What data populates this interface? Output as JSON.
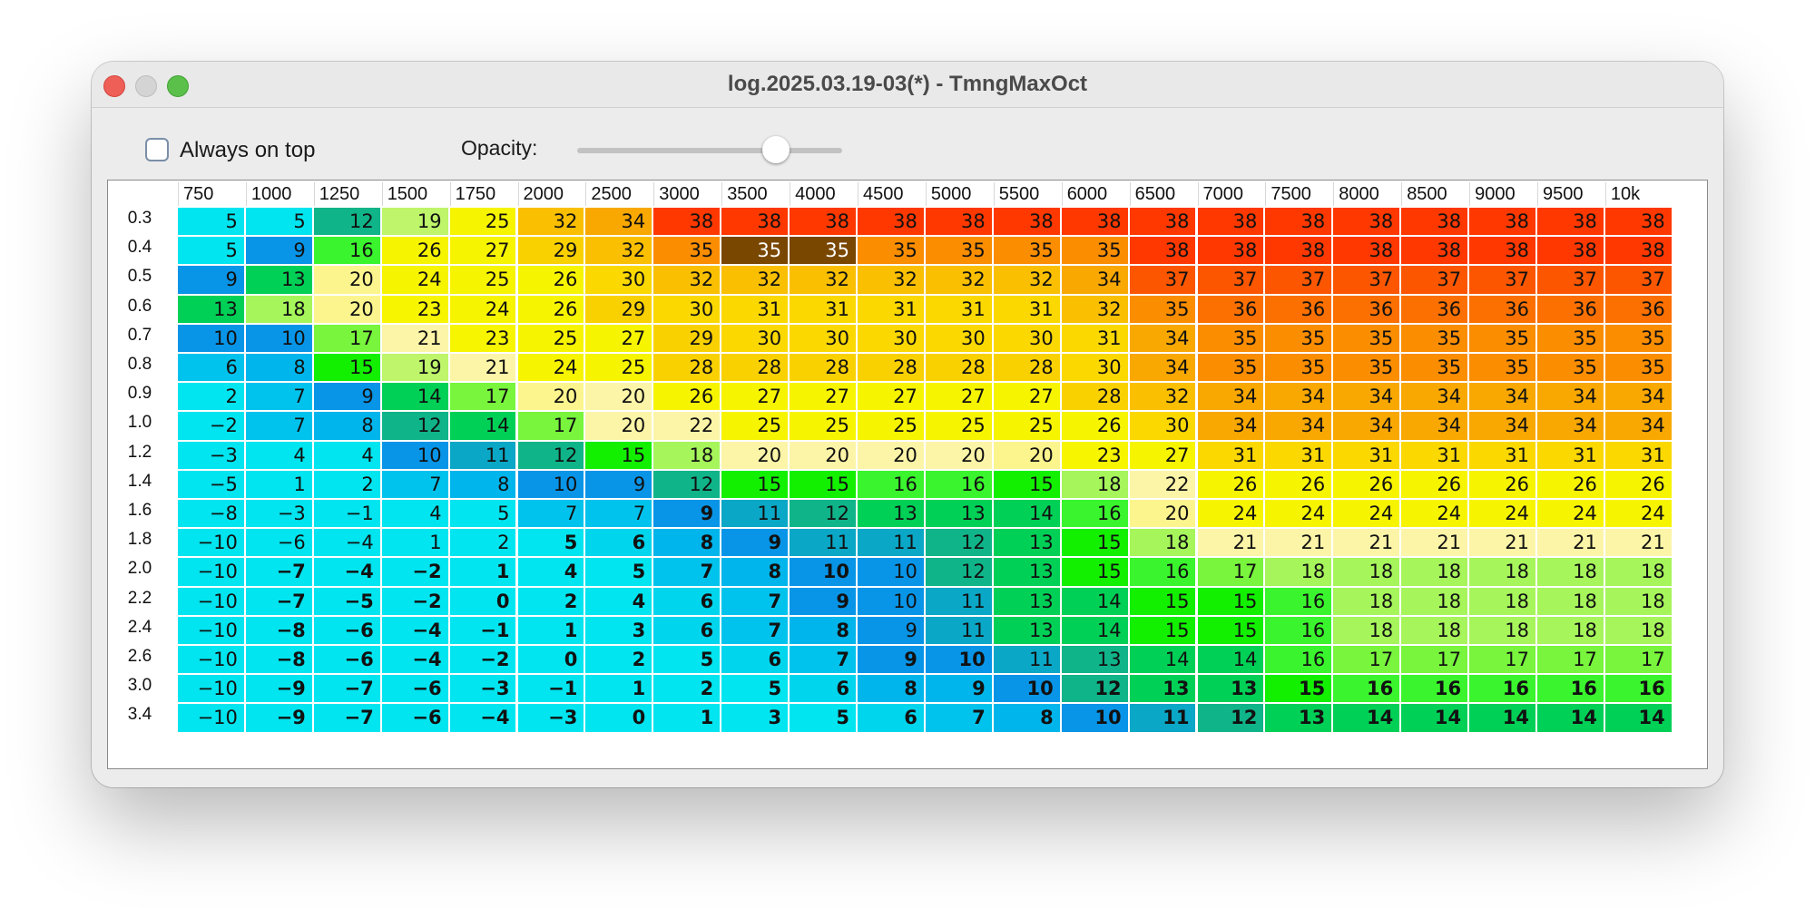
{
  "window": {
    "title": "log.2025.03.19-03(*) - TmngMaxOct"
  },
  "toolbar": {
    "always_on_top_label": "Always on top",
    "always_on_top_checked": false,
    "opacity_label": "Opacity:",
    "opacity_value": 0.75
  },
  "table": {
    "columns": [
      "750",
      "1000",
      "1250",
      "1500",
      "1750",
      "2000",
      "2500",
      "3000",
      "3500",
      "4000",
      "4500",
      "5000",
      "5500",
      "6000",
      "6500",
      "7000",
      "7500",
      "8000",
      "8500",
      "9000",
      "9500",
      "10k"
    ],
    "rows": [
      {
        "label": "0.3",
        "values": [
          "5",
          "5",
          "12",
          "19",
          "25",
          "32",
          "34",
          "38",
          "38",
          "38",
          "38",
          "38",
          "38",
          "38",
          "38",
          "38",
          "38",
          "38",
          "38",
          "38",
          "38",
          "38"
        ],
        "colors": [
          "#00e5ef",
          "#00e5ef",
          "#10b489",
          "#bef56a",
          "#f7f400",
          "#f9bf00",
          "#f8a800",
          "#ff3800",
          "#ff3800",
          "#ff3800",
          "#ff3800",
          "#ff3800",
          "#ff3800",
          "#ff3800",
          "#ff3800",
          "#ff3800",
          "#ff3800",
          "#ff3800",
          "#ff3800",
          "#ff3800",
          "#ff3800",
          "#ff3800"
        ]
      },
      {
        "label": "0.4",
        "values": [
          "5",
          "9",
          "16",
          "26",
          "27",
          "29",
          "32",
          "35",
          "35",
          "35",
          "35",
          "35",
          "35",
          "35",
          "38",
          "38",
          "38",
          "38",
          "38",
          "38",
          "38",
          "38"
        ],
        "colors": [
          "#00e5ef",
          "#0895e8",
          "#3af52d",
          "#f7f400",
          "#f7f400",
          "#fad100",
          "#f9bf00",
          "#fb8d00",
          "#7a4700",
          "#7a4700",
          "#fb8d00",
          "#fb8d00",
          "#fb8d00",
          "#fb8d00",
          "#ff3800",
          "#ff3800",
          "#ff3800",
          "#ff3800",
          "#ff3800",
          "#ff3800",
          "#ff3800",
          "#ff3800"
        ]
      },
      {
        "label": "0.5",
        "values": [
          "9",
          "13",
          "20",
          "24",
          "25",
          "26",
          "30",
          "32",
          "32",
          "32",
          "32",
          "32",
          "32",
          "34",
          "37",
          "37",
          "37",
          "37",
          "37",
          "37",
          "37",
          "37"
        ],
        "colors": [
          "#0895e8",
          "#00d056",
          "#fcf58e",
          "#f7f400",
          "#f7f400",
          "#f7f400",
          "#fbd800",
          "#f9bf00",
          "#f9bf00",
          "#f9bf00",
          "#f9bf00",
          "#f9bf00",
          "#f9bf00",
          "#f8a800",
          "#fc5600",
          "#fc5600",
          "#fc5600",
          "#fc5600",
          "#fc5600",
          "#fc5600",
          "#fc5600",
          "#fc5600"
        ]
      },
      {
        "label": "0.6",
        "values": [
          "13",
          "18",
          "20",
          "23",
          "24",
          "26",
          "29",
          "30",
          "31",
          "31",
          "31",
          "31",
          "31",
          "32",
          "35",
          "36",
          "36",
          "36",
          "36",
          "36",
          "36",
          "36"
        ],
        "colors": [
          "#00d056",
          "#a6f55b",
          "#fcf58e",
          "#f8f500",
          "#f7f400",
          "#f7f400",
          "#fad100",
          "#fbd800",
          "#fbd800",
          "#fbd800",
          "#fbd800",
          "#fbd800",
          "#fbd800",
          "#f9bf00",
          "#fb8d00",
          "#fb7000",
          "#fb7000",
          "#fb7000",
          "#fb7000",
          "#fb7000",
          "#fb7000",
          "#fb7000"
        ]
      },
      {
        "label": "0.7",
        "values": [
          "10",
          "10",
          "17",
          "21",
          "23",
          "25",
          "27",
          "29",
          "30",
          "30",
          "30",
          "30",
          "30",
          "31",
          "34",
          "35",
          "35",
          "35",
          "35",
          "35",
          "35",
          "35"
        ],
        "colors": [
          "#0895e8",
          "#0895e8",
          "#78f53c",
          "#fcf5a8",
          "#f8f500",
          "#f7f400",
          "#f7f400",
          "#fad100",
          "#fbd800",
          "#fbd800",
          "#fbd800",
          "#fbd800",
          "#fbd800",
          "#fbd800",
          "#f8a800",
          "#fb8d00",
          "#fb8d00",
          "#fb8d00",
          "#fb8d00",
          "#fb8d00",
          "#fb8d00",
          "#fb8d00"
        ]
      },
      {
        "label": "0.8",
        "values": [
          "6",
          "8",
          "15",
          "19",
          "21",
          "24",
          "25",
          "28",
          "28",
          "28",
          "28",
          "28",
          "28",
          "30",
          "34",
          "35",
          "35",
          "35",
          "35",
          "35",
          "35",
          "35"
        ],
        "colors": [
          "#00c3ed",
          "#00b5eb",
          "#12f000",
          "#bef56a",
          "#fcf5a8",
          "#f7f400",
          "#f7f400",
          "#fad100",
          "#fad100",
          "#fad100",
          "#fad100",
          "#fad100",
          "#fad100",
          "#fbd800",
          "#f8a800",
          "#fb8d00",
          "#fb8d00",
          "#fb8d00",
          "#fb8d00",
          "#fb8d00",
          "#fb8d00",
          "#fb8d00"
        ]
      },
      {
        "label": "0.9",
        "values": [
          "2",
          "7",
          "9",
          "14",
          "17",
          "20",
          "20",
          "26",
          "27",
          "27",
          "27",
          "27",
          "27",
          "28",
          "32",
          "34",
          "34",
          "34",
          "34",
          "34",
          "34",
          "34"
        ],
        "colors": [
          "#00e5ef",
          "#00c3ed",
          "#0895e8",
          "#00d056",
          "#78f53c",
          "#fcf58e",
          "#fcf5a8",
          "#f7f400",
          "#f7f400",
          "#f7f400",
          "#f7f400",
          "#f7f400",
          "#f7f400",
          "#fad100",
          "#f9bf00",
          "#f8a800",
          "#f8a800",
          "#f8a800",
          "#f8a800",
          "#f8a800",
          "#f8a800",
          "#f8a800"
        ]
      },
      {
        "label": "1.0",
        "values": [
          "-2",
          "7",
          "8",
          "12",
          "14",
          "17",
          "20",
          "22",
          "25",
          "25",
          "25",
          "25",
          "25",
          "26",
          "30",
          "34",
          "34",
          "34",
          "34",
          "34",
          "34",
          "34"
        ],
        "colors": [
          "#00e5ef",
          "#00c3ed",
          "#00b5eb",
          "#10b489",
          "#00d056",
          "#78f53c",
          "#fcf5a8",
          "#fcf5a8",
          "#f7f400",
          "#f7f400",
          "#f7f400",
          "#f7f400",
          "#f7f400",
          "#f7f400",
          "#fbd800",
          "#f8a800",
          "#f8a800",
          "#f8a800",
          "#f8a800",
          "#f8a800",
          "#f8a800",
          "#f8a800"
        ]
      },
      {
        "label": "1.2",
        "values": [
          "-3",
          "4",
          "4",
          "10",
          "11",
          "12",
          "15",
          "18",
          "20",
          "20",
          "20",
          "20",
          "20",
          "23",
          "27",
          "31",
          "31",
          "31",
          "31",
          "31",
          "31",
          "31"
        ],
        "colors": [
          "#00e5ef",
          "#00e5ef",
          "#00e5ef",
          "#0895e8",
          "#0aa7c6",
          "#10b489",
          "#12f000",
          "#a6f55b",
          "#fcf5a8",
          "#fcf5a8",
          "#fcf5a8",
          "#fcf5a8",
          "#fcf58e",
          "#f8f500",
          "#f7f400",
          "#fbd800",
          "#fbd800",
          "#fbd800",
          "#fbd800",
          "#fbd800",
          "#fbd800",
          "#fbd800"
        ]
      },
      {
        "label": "1.4",
        "values": [
          "-5",
          "1",
          "2",
          "7",
          "8",
          "10",
          "9",
          "12",
          "15",
          "15",
          "16",
          "16",
          "15",
          "18",
          "22",
          "26",
          "26",
          "26",
          "26",
          "26",
          "26",
          "26"
        ],
        "colors": [
          "#00e5ef",
          "#00e5ef",
          "#00e5ef",
          "#00c3ed",
          "#00b5eb",
          "#0895e8",
          "#0895e8",
          "#10b489",
          "#12f000",
          "#12f000",
          "#3af52d",
          "#3af52d",
          "#12f000",
          "#a6f55b",
          "#fcf5a8",
          "#f7f400",
          "#f7f400",
          "#f7f400",
          "#f7f400",
          "#f7f400",
          "#f7f400",
          "#f7f400"
        ]
      },
      {
        "label": "1.6",
        "values": [
          "-8",
          "-3",
          "-1",
          "4",
          "5",
          "7",
          "7",
          "9",
          "11",
          "12",
          "13",
          "13",
          "14",
          "16",
          "20",
          "24",
          "24",
          "24",
          "24",
          "24",
          "24",
          "24"
        ],
        "colors": [
          "#00e5ef",
          "#00e5ef",
          "#00e5ef",
          "#00e5ef",
          "#00e5ef",
          "#00c3ed",
          "#00c3ed",
          "#0895e8",
          "#0aa7c6",
          "#10b489",
          "#00d056",
          "#00d056",
          "#00d056",
          "#3af52d",
          "#fcf58e",
          "#f7f400",
          "#f7f400",
          "#f7f400",
          "#f7f400",
          "#f7f400",
          "#f7f400",
          "#f7f400"
        ]
      },
      {
        "label": "1.8",
        "values": [
          "-10",
          "-6",
          "-4",
          "1",
          "2",
          "5",
          "6",
          "8",
          "9",
          "11",
          "11",
          "12",
          "13",
          "15",
          "18",
          "21",
          "21",
          "21",
          "21",
          "21",
          "21",
          "21"
        ],
        "colors": [
          "#00e5ef",
          "#00e5ef",
          "#00e5ef",
          "#00e5ef",
          "#00e5ef",
          "#00e5ef",
          "#00d5ee",
          "#00b5eb",
          "#0895e8",
          "#0aa7c6",
          "#0aa7c6",
          "#10b489",
          "#00d056",
          "#12f000",
          "#a6f55b",
          "#fcf5a8",
          "#fcf5a8",
          "#fcf5a8",
          "#fcf5a8",
          "#fcf5a8",
          "#fcf5a8",
          "#fcf5a8"
        ]
      },
      {
        "label": "2.0",
        "values": [
          "-10",
          "-7",
          "-4",
          "-2",
          "1",
          "4",
          "5",
          "7",
          "8",
          "10",
          "10",
          "12",
          "13",
          "15",
          "16",
          "17",
          "18",
          "18",
          "18",
          "18",
          "18",
          "18"
        ],
        "colors": [
          "#00e5ef",
          "#00e5ef",
          "#00e5ef",
          "#00e5ef",
          "#00e5ef",
          "#00e5ef",
          "#00e5ef",
          "#00c3ed",
          "#00b5eb",
          "#0895e8",
          "#0895e8",
          "#10b489",
          "#00d056",
          "#12f000",
          "#3af52d",
          "#78f53c",
          "#a6f55b",
          "#a6f55b",
          "#a6f55b",
          "#a6f55b",
          "#a6f55b",
          "#a6f55b"
        ]
      },
      {
        "label": "2.2",
        "values": [
          "-10",
          "-7",
          "-5",
          "-2",
          "0",
          "2",
          "4",
          "6",
          "7",
          "9",
          "10",
          "11",
          "13",
          "14",
          "15",
          "15",
          "16",
          "18",
          "18",
          "18",
          "18",
          "18"
        ],
        "colors": [
          "#00e5ef",
          "#00e5ef",
          "#00e5ef",
          "#00e5ef",
          "#00e5ef",
          "#00e5ef",
          "#00e5ef",
          "#00d5ee",
          "#00c3ed",
          "#0895e8",
          "#0895e8",
          "#0aa7c6",
          "#00d056",
          "#00d056",
          "#12f000",
          "#12f000",
          "#3af52d",
          "#a6f55b",
          "#a6f55b",
          "#a6f55b",
          "#a6f55b",
          "#a6f55b"
        ]
      },
      {
        "label": "2.4",
        "values": [
          "-10",
          "-8",
          "-6",
          "-4",
          "-1",
          "1",
          "3",
          "6",
          "7",
          "8",
          "9",
          "11",
          "13",
          "14",
          "15",
          "15",
          "16",
          "18",
          "18",
          "18",
          "18",
          "18"
        ],
        "colors": [
          "#00e5ef",
          "#00e5ef",
          "#00e5ef",
          "#00e5ef",
          "#00e5ef",
          "#00e5ef",
          "#00e5ef",
          "#00d5ee",
          "#00c3ed",
          "#00b5eb",
          "#0895e8",
          "#0aa7c6",
          "#00d056",
          "#00d056",
          "#12f000",
          "#12f000",
          "#3af52d",
          "#a6f55b",
          "#a6f55b",
          "#a6f55b",
          "#a6f55b",
          "#a6f55b"
        ]
      },
      {
        "label": "2.6",
        "values": [
          "-10",
          "-8",
          "-6",
          "-4",
          "-2",
          "0",
          "2",
          "5",
          "6",
          "7",
          "9",
          "10",
          "11",
          "13",
          "14",
          "14",
          "16",
          "17",
          "17",
          "17",
          "17",
          "17"
        ],
        "colors": [
          "#00e5ef",
          "#00e5ef",
          "#00e5ef",
          "#00e5ef",
          "#00e5ef",
          "#00e5ef",
          "#00e5ef",
          "#00e5ef",
          "#00d5ee",
          "#00c3ed",
          "#0895e8",
          "#0895e8",
          "#0aa7c6",
          "#10b489",
          "#00d056",
          "#00d056",
          "#3af52d",
          "#78f53c",
          "#78f53c",
          "#78f53c",
          "#78f53c",
          "#78f53c"
        ]
      },
      {
        "label": "3.0",
        "values": [
          "-10",
          "-9",
          "-7",
          "-6",
          "-3",
          "-1",
          "1",
          "2",
          "5",
          "6",
          "8",
          "9",
          "10",
          "12",
          "13",
          "13",
          "15",
          "16",
          "16",
          "16",
          "16",
          "16"
        ],
        "colors": [
          "#00e5ef",
          "#00e5ef",
          "#00e5ef",
          "#00e5ef",
          "#00e5ef",
          "#00e5ef",
          "#00e5ef",
          "#00e5ef",
          "#00e5ef",
          "#00d5ee",
          "#00b5eb",
          "#00b5eb",
          "#0895e8",
          "#10b489",
          "#00d056",
          "#00d056",
          "#12f000",
          "#3af52d",
          "#3af52d",
          "#3af52d",
          "#3af52d",
          "#3af52d"
        ]
      },
      {
        "label": "3.4",
        "values": [
          "-10",
          "-9",
          "-7",
          "-6",
          "-4",
          "-3",
          "0",
          "1",
          "3",
          "5",
          "6",
          "7",
          "8",
          "10",
          "11",
          "12",
          "13",
          "14",
          "14",
          "14",
          "14",
          "14"
        ],
        "colors": [
          "#00e5ef",
          "#00e5ef",
          "#00e5ef",
          "#00e5ef",
          "#00e5ef",
          "#00e5ef",
          "#00e5ef",
          "#00e5ef",
          "#00e5ef",
          "#00e5ef",
          "#00d5ee",
          "#00c3ed",
          "#00b5eb",
          "#0895e8",
          "#0aa7c6",
          "#10b489",
          "#00d056",
          "#00d056",
          "#00d056",
          "#00d056",
          "#00d056",
          "#00d056"
        ]
      }
    ],
    "bold_map": [
      "0000000000000000000000",
      "0000000000000000000000",
      "0000000000000000000000",
      "0000000000000000000000",
      "0000000000000000000000",
      "0000000000000000000000",
      "0000000000000000000000",
      "0000000000000000000000",
      "0000000000000000000000",
      "0000000000000000000000",
      "0000000100000000000000",
      "0000011110000000000000",
      "0111111111000000000000",
      "0111111111000000000000",
      "0111111111000000000000",
      "0111111111110000000000",
      "0111111111111111111111",
      "0111111111111111111111"
    ],
    "light_text_cells": [
      "1-8",
      "1-9"
    ]
  }
}
